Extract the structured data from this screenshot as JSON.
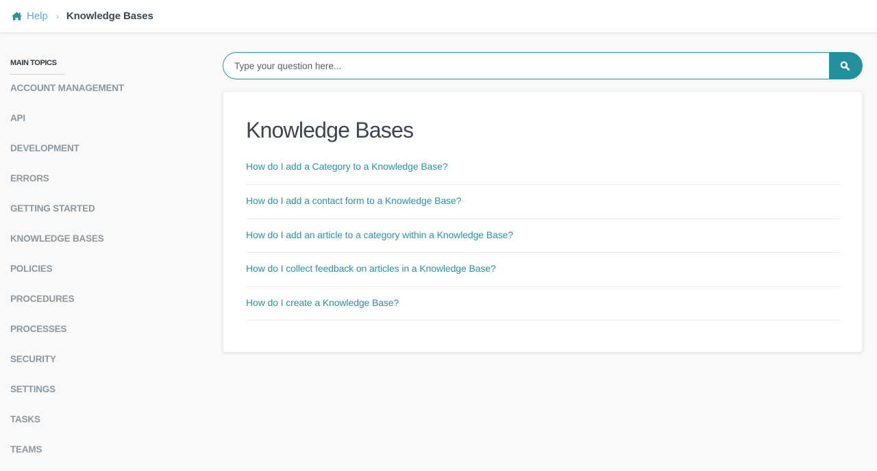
{
  "breadcrumb": {
    "home_icon": "home-icon",
    "help_label": "Help",
    "separator": "›",
    "current": "Knowledge Bases"
  },
  "sidebar": {
    "title": "MAIN TOPICS",
    "items": [
      {
        "label": "ACCOUNT MANAGEMENT"
      },
      {
        "label": "API"
      },
      {
        "label": "DEVELOPMENT"
      },
      {
        "label": "ERRORS"
      },
      {
        "label": "GETTING STARTED"
      },
      {
        "label": "KNOWLEDGE BASES"
      },
      {
        "label": "POLICIES"
      },
      {
        "label": "PROCEDURES"
      },
      {
        "label": "PROCESSES"
      },
      {
        "label": "SECURITY"
      },
      {
        "label": "SETTINGS"
      },
      {
        "label": "TASKS"
      },
      {
        "label": "TEAMS"
      }
    ]
  },
  "search": {
    "placeholder": "Type your question here...",
    "value": "",
    "button_icon": "search-icon"
  },
  "main": {
    "title": "Knowledge Bases",
    "articles": [
      {
        "label": "How do I add a Category to a Knowledge Base?"
      },
      {
        "label": "How do I add a contact form to a Knowledge Base?"
      },
      {
        "label": "How do I add an article to a category within a Knowledge Base?"
      },
      {
        "label": "How do I collect feedback on articles in a Knowledge Base?"
      },
      {
        "label": "How do I create a Knowledge Base?"
      }
    ]
  },
  "colors": {
    "accent": "#2a93a1",
    "search_button": "#22919d",
    "sidebar_text": "#8c979f",
    "heading": "#3c4650"
  }
}
